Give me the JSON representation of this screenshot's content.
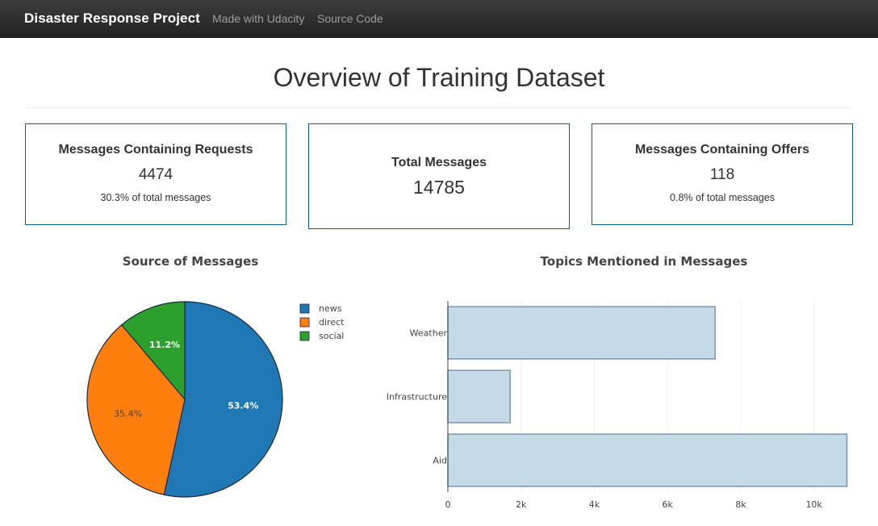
{
  "navbar": {
    "brand": "Disaster Response Project",
    "links": [
      "Made with Udacity",
      "Source Code"
    ]
  },
  "page_title": "Overview of Training Dataset",
  "cards": [
    {
      "title": "Messages Containing Requests",
      "value": "4474",
      "note": "30.3% of total messages"
    },
    {
      "title": "Total Messages",
      "value": "14785"
    },
    {
      "title": "Messages Containing Offers",
      "value": "118",
      "note": "0.8% of total messages"
    }
  ],
  "colors": {
    "news": "#1f77b4",
    "direct": "#ff7f0e",
    "social": "#2ca02c",
    "bar_fill": "#c6dbea",
    "bar_stroke": "#7d93ad",
    "card_border": "#0c5f7a"
  },
  "chart_data": [
    {
      "type": "pie",
      "title": "Source of Messages",
      "labels": [
        "news",
        "direct",
        "social"
      ],
      "values": [
        53.4,
        35.4,
        11.2
      ],
      "value_labels": [
        "53.4%",
        "35.4%",
        "11.2%"
      ],
      "legend": "right"
    },
    {
      "type": "bar",
      "orientation": "horizontal",
      "title": "Topics Mentioned in Messages",
      "categories": [
        "Weather",
        "Infrastructure",
        "Aid"
      ],
      "values": [
        7300,
        1700,
        10900
      ],
      "xlim": [
        0,
        11000
      ],
      "xticks": [
        0,
        2000,
        4000,
        6000,
        8000,
        10000
      ],
      "xtick_labels": [
        "0",
        "2k",
        "4k",
        "6k",
        "8k",
        "10k"
      ],
      "grid": true
    }
  ]
}
